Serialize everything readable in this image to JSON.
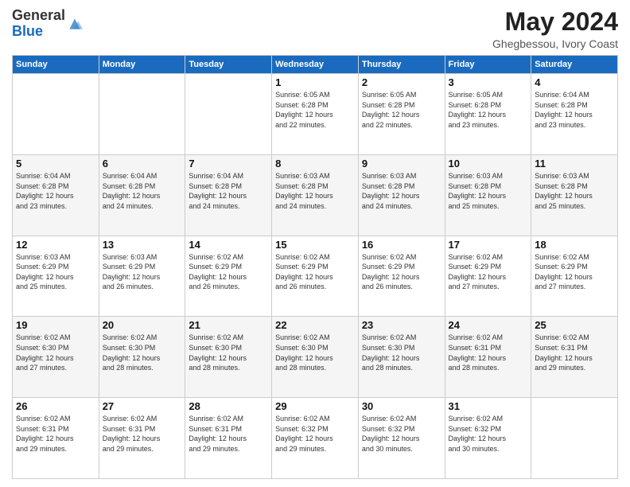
{
  "logo": {
    "general": "General",
    "blue": "Blue"
  },
  "title": "May 2024",
  "subtitle": "Ghegbessou, Ivory Coast",
  "weekdays": [
    "Sunday",
    "Monday",
    "Tuesday",
    "Wednesday",
    "Thursday",
    "Friday",
    "Saturday"
  ],
  "weeks": [
    [
      {
        "day": "",
        "info": ""
      },
      {
        "day": "",
        "info": ""
      },
      {
        "day": "",
        "info": ""
      },
      {
        "day": "1",
        "info": "Sunrise: 6:05 AM\nSunset: 6:28 PM\nDaylight: 12 hours\nand 22 minutes."
      },
      {
        "day": "2",
        "info": "Sunrise: 6:05 AM\nSunset: 6:28 PM\nDaylight: 12 hours\nand 22 minutes."
      },
      {
        "day": "3",
        "info": "Sunrise: 6:05 AM\nSunset: 6:28 PM\nDaylight: 12 hours\nand 23 minutes."
      },
      {
        "day": "4",
        "info": "Sunrise: 6:04 AM\nSunset: 6:28 PM\nDaylight: 12 hours\nand 23 minutes."
      }
    ],
    [
      {
        "day": "5",
        "info": "Sunrise: 6:04 AM\nSunset: 6:28 PM\nDaylight: 12 hours\nand 23 minutes."
      },
      {
        "day": "6",
        "info": "Sunrise: 6:04 AM\nSunset: 6:28 PM\nDaylight: 12 hours\nand 24 minutes."
      },
      {
        "day": "7",
        "info": "Sunrise: 6:04 AM\nSunset: 6:28 PM\nDaylight: 12 hours\nand 24 minutes."
      },
      {
        "day": "8",
        "info": "Sunrise: 6:03 AM\nSunset: 6:28 PM\nDaylight: 12 hours\nand 24 minutes."
      },
      {
        "day": "9",
        "info": "Sunrise: 6:03 AM\nSunset: 6:28 PM\nDaylight: 12 hours\nand 24 minutes."
      },
      {
        "day": "10",
        "info": "Sunrise: 6:03 AM\nSunset: 6:28 PM\nDaylight: 12 hours\nand 25 minutes."
      },
      {
        "day": "11",
        "info": "Sunrise: 6:03 AM\nSunset: 6:28 PM\nDaylight: 12 hours\nand 25 minutes."
      }
    ],
    [
      {
        "day": "12",
        "info": "Sunrise: 6:03 AM\nSunset: 6:29 PM\nDaylight: 12 hours\nand 25 minutes."
      },
      {
        "day": "13",
        "info": "Sunrise: 6:03 AM\nSunset: 6:29 PM\nDaylight: 12 hours\nand 26 minutes."
      },
      {
        "day": "14",
        "info": "Sunrise: 6:02 AM\nSunset: 6:29 PM\nDaylight: 12 hours\nand 26 minutes."
      },
      {
        "day": "15",
        "info": "Sunrise: 6:02 AM\nSunset: 6:29 PM\nDaylight: 12 hours\nand 26 minutes."
      },
      {
        "day": "16",
        "info": "Sunrise: 6:02 AM\nSunset: 6:29 PM\nDaylight: 12 hours\nand 26 minutes."
      },
      {
        "day": "17",
        "info": "Sunrise: 6:02 AM\nSunset: 6:29 PM\nDaylight: 12 hours\nand 27 minutes."
      },
      {
        "day": "18",
        "info": "Sunrise: 6:02 AM\nSunset: 6:29 PM\nDaylight: 12 hours\nand 27 minutes."
      }
    ],
    [
      {
        "day": "19",
        "info": "Sunrise: 6:02 AM\nSunset: 6:30 PM\nDaylight: 12 hours\nand 27 minutes."
      },
      {
        "day": "20",
        "info": "Sunrise: 6:02 AM\nSunset: 6:30 PM\nDaylight: 12 hours\nand 28 minutes."
      },
      {
        "day": "21",
        "info": "Sunrise: 6:02 AM\nSunset: 6:30 PM\nDaylight: 12 hours\nand 28 minutes."
      },
      {
        "day": "22",
        "info": "Sunrise: 6:02 AM\nSunset: 6:30 PM\nDaylight: 12 hours\nand 28 minutes."
      },
      {
        "day": "23",
        "info": "Sunrise: 6:02 AM\nSunset: 6:30 PM\nDaylight: 12 hours\nand 28 minutes."
      },
      {
        "day": "24",
        "info": "Sunrise: 6:02 AM\nSunset: 6:31 PM\nDaylight: 12 hours\nand 28 minutes."
      },
      {
        "day": "25",
        "info": "Sunrise: 6:02 AM\nSunset: 6:31 PM\nDaylight: 12 hours\nand 29 minutes."
      }
    ],
    [
      {
        "day": "26",
        "info": "Sunrise: 6:02 AM\nSunset: 6:31 PM\nDaylight: 12 hours\nand 29 minutes."
      },
      {
        "day": "27",
        "info": "Sunrise: 6:02 AM\nSunset: 6:31 PM\nDaylight: 12 hours\nand 29 minutes."
      },
      {
        "day": "28",
        "info": "Sunrise: 6:02 AM\nSunset: 6:31 PM\nDaylight: 12 hours\nand 29 minutes."
      },
      {
        "day": "29",
        "info": "Sunrise: 6:02 AM\nSunset: 6:32 PM\nDaylight: 12 hours\nand 29 minutes."
      },
      {
        "day": "30",
        "info": "Sunrise: 6:02 AM\nSunset: 6:32 PM\nDaylight: 12 hours\nand 30 minutes."
      },
      {
        "day": "31",
        "info": "Sunrise: 6:02 AM\nSunset: 6:32 PM\nDaylight: 12 hours\nand 30 minutes."
      },
      {
        "day": "",
        "info": ""
      }
    ]
  ]
}
